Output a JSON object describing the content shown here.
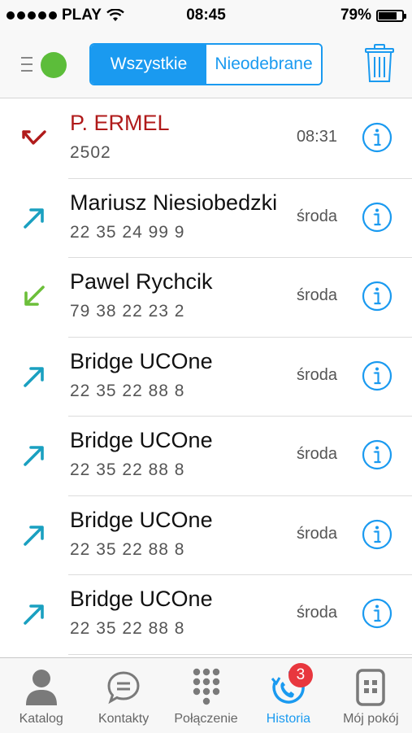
{
  "status_bar": {
    "carrier": "PLAY",
    "time": "08:45",
    "battery": "79%",
    "battery_level": 0.79
  },
  "segments": {
    "all": "Wszystkie",
    "missed": "Nieodebrane"
  },
  "calls": [
    {
      "name": "P. ERMEL",
      "number": "2502",
      "time": "08:31",
      "direction": "missed"
    },
    {
      "name": "Mariusz Niesiobedzki",
      "number": "22 35 24 99 9",
      "time": "środa",
      "direction": "outgoing"
    },
    {
      "name": "Pawel Rychcik",
      "number": "79 38 22 23 2",
      "time": "środa",
      "direction": "incoming"
    },
    {
      "name": "Bridge UCOne",
      "number": "22 35 22 88 8",
      "time": "środa",
      "direction": "outgoing"
    },
    {
      "name": "Bridge UCOne",
      "number": "22 35 22 88 8",
      "time": "środa",
      "direction": "outgoing"
    },
    {
      "name": "Bridge UCOne",
      "number": "22 35 22 88 8",
      "time": "środa",
      "direction": "outgoing"
    },
    {
      "name": "Bridge UCOne",
      "number": "22 35 22 88 8",
      "time": "środa",
      "direction": "outgoing"
    }
  ],
  "tabs": [
    {
      "label": "Katalog",
      "icon": "person-icon"
    },
    {
      "label": "Kontakty",
      "icon": "chat-bubble-icon"
    },
    {
      "label": "Połączenie",
      "icon": "dialpad-icon"
    },
    {
      "label": "Historia",
      "icon": "history-icon",
      "badge": "3"
    },
    {
      "label": "Mój pokój",
      "icon": "room-icon"
    }
  ],
  "colors": {
    "accent": "#1a9af0",
    "missed": "#b01a1a",
    "outgoing": "#1aa0c0",
    "incoming": "#6cbf3a",
    "presence": "#5cbd3a",
    "badge": "#e8373e"
  }
}
